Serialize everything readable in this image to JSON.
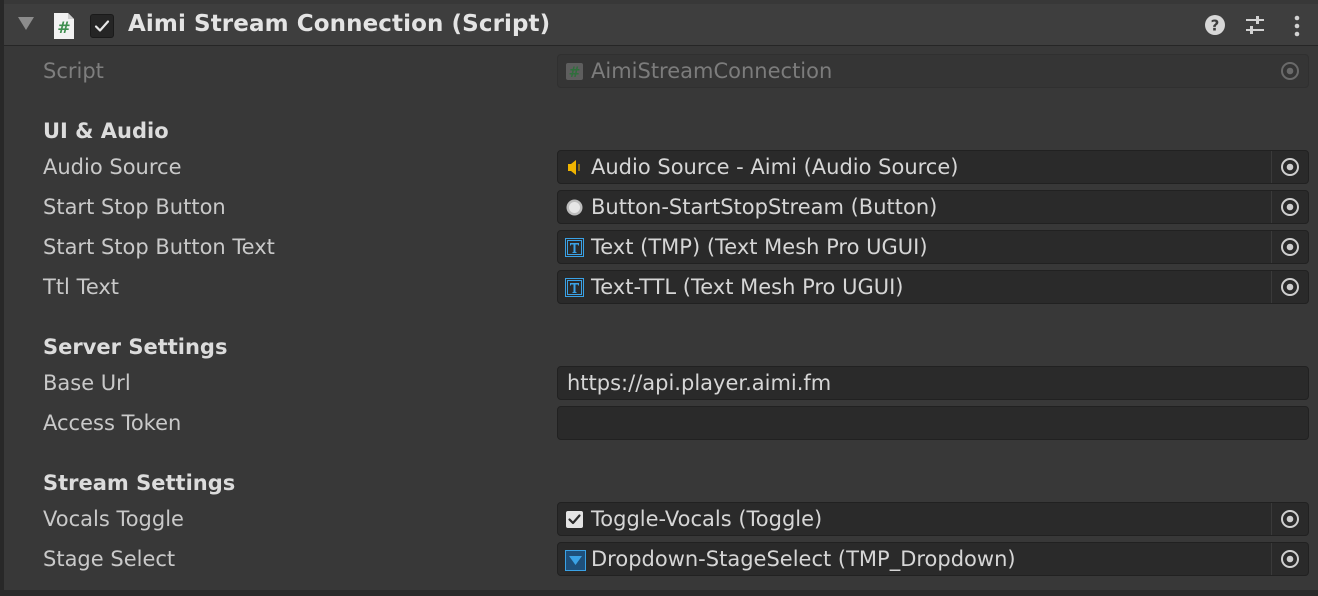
{
  "header": {
    "title": "Aimi Stream Connection (Script)"
  },
  "script_field": {
    "label": "Script",
    "value": "AimiStreamConnection"
  },
  "sections": {
    "ui_audio": "UI & Audio",
    "server": "Server Settings",
    "stream": "Stream Settings"
  },
  "fields": {
    "audio_source": {
      "label": "Audio Source",
      "value": "Audio Source - Aimi (Audio Source)",
      "icon": "audio-source-icon"
    },
    "start_stop_button": {
      "label": "Start Stop Button",
      "value": "Button-StartStopStream (Button)",
      "icon": "button-icon"
    },
    "start_stop_button_text": {
      "label": "Start Stop Button Text",
      "value": "Text (TMP) (Text Mesh Pro UGUI)",
      "icon": "textmeshpro-icon"
    },
    "ttl_text": {
      "label": "Ttl Text",
      "value": "Text-TTL (Text Mesh Pro UGUI)",
      "icon": "textmeshpro-icon"
    },
    "base_url": {
      "label": "Base Url",
      "value": "https://api.player.aimi.fm"
    },
    "access_token": {
      "label": "Access Token",
      "value": ""
    },
    "vocals_toggle": {
      "label": "Vocals Toggle",
      "value": "Toggle-Vocals (Toggle)",
      "icon": "toggle-icon"
    },
    "stage_select": {
      "label": "Stage Select",
      "value": "Dropdown-StageSelect (TMP_Dropdown)",
      "icon": "dropdown-icon"
    }
  },
  "colors": {
    "background": "#383838",
    "field_background": "#2a2a2a",
    "audio_icon": "#f0b400",
    "tmp_icon": "#3aa2e6",
    "script_icon": "#3f8f4f"
  }
}
